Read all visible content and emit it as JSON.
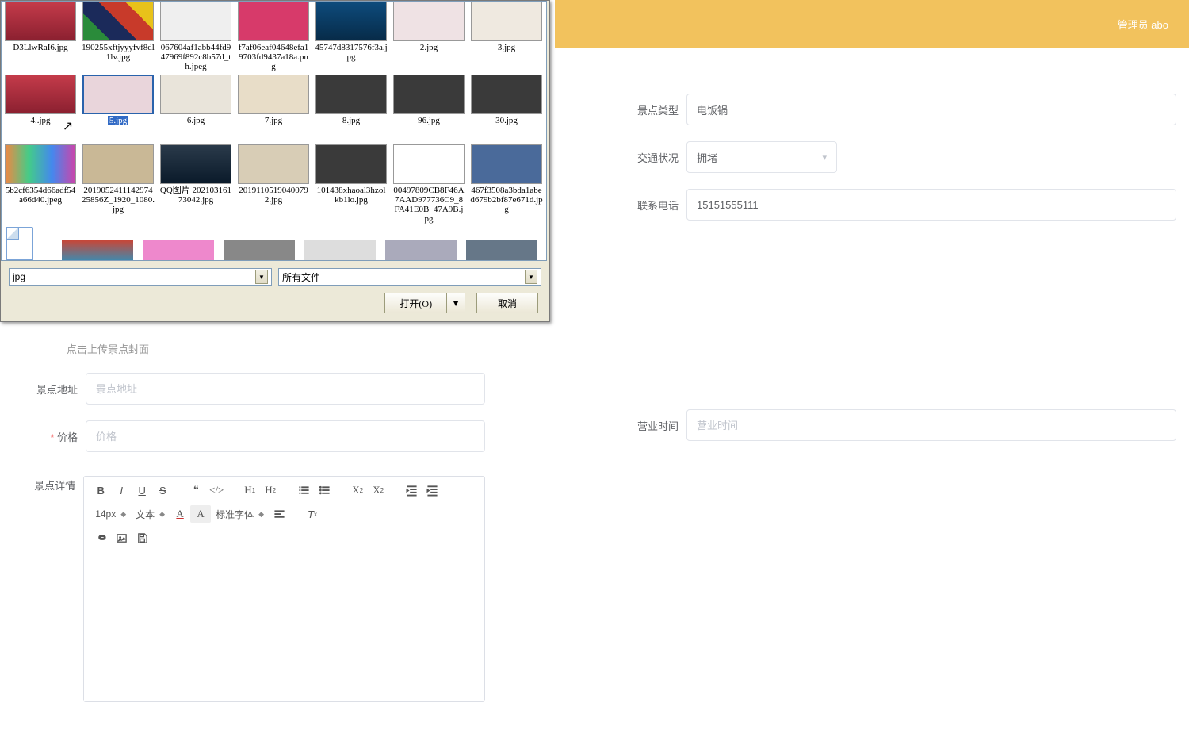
{
  "header": {
    "admin_label": "管理员 abo"
  },
  "form": {
    "type_label": "景点类型",
    "type_value": "电饭锅",
    "traffic_label": "交通状况",
    "traffic_value": "拥堵",
    "phone_label": "联系电话",
    "phone_value": "15151555111",
    "hours_label": "营业时间",
    "hours_placeholder": "营业时间",
    "addr_label": "景点地址",
    "addr_placeholder": "景点地址",
    "price_label": "价格",
    "price_placeholder": "价格",
    "detail_label": "景点详情",
    "upload_hint": "点击上传景点封面"
  },
  "editor": {
    "font_size": "14px",
    "text_label": "文本",
    "font_family": "标准字体"
  },
  "dialog": {
    "filename_value": "jpg",
    "filter_label": "所有文件",
    "open_btn": "打开(O)",
    "cancel_btn": "取消",
    "files_row1": [
      {
        "name": "D3LlwRaI6.jpg",
        "cls": "p-red"
      },
      {
        "name": "190255xftjyyyfvf8dl1lv.jpg",
        "cls": "p-shoes"
      },
      {
        "name": "067604af1abb44fd947969f892c8b57d_th.jpeg",
        "cls": "p-sneak"
      },
      {
        "name": "f7af06eaf04648efa19703fd9437a18a.png",
        "cls": "p-pink"
      },
      {
        "name": "45747d8317576f3a.jpg",
        "cls": "p-blue"
      },
      {
        "name": "2.jpg",
        "cls": "p-cos1"
      },
      {
        "name": "3.jpg",
        "cls": "p-cos2"
      }
    ],
    "files_row2": [
      {
        "name": "4..jpg",
        "cls": "p-red"
      },
      {
        "name": "5.jpg",
        "cls": "p-cos1",
        "selected": true
      },
      {
        "name": "6.jpg",
        "cls": "p-cos3"
      },
      {
        "name": "7.jpg",
        "cls": "p-beige"
      },
      {
        "name": "8.jpg",
        "cls": "p-dark"
      },
      {
        "name": "96.jpg",
        "cls": "p-dark"
      },
      {
        "name": "30.jpg",
        "cls": "p-dark"
      }
    ],
    "files_row3": [
      {
        "name": "5b2cf6354d66adf54a66d40.jpeg",
        "cls": "p-color"
      },
      {
        "name": "201905241114297425856Z_1920_1080.jpg",
        "cls": "p-store"
      },
      {
        "name": "QQ图片\n20210316173042.jpg",
        "cls": "p-car"
      },
      {
        "name": "20191105190400792.jpg",
        "cls": "p-store2"
      },
      {
        "name": "101438xhaoal3hzolkb1lo.jpg",
        "cls": "p-sign"
      },
      {
        "name": "00497809CB8F46A7AAD977736C9_8FA41E0B_47A9B.jpg",
        "cls": "p-logo"
      },
      {
        "name": "467f3508a3bda1abed679b2bf87e671d.jpg",
        "cls": "p-build"
      }
    ]
  }
}
